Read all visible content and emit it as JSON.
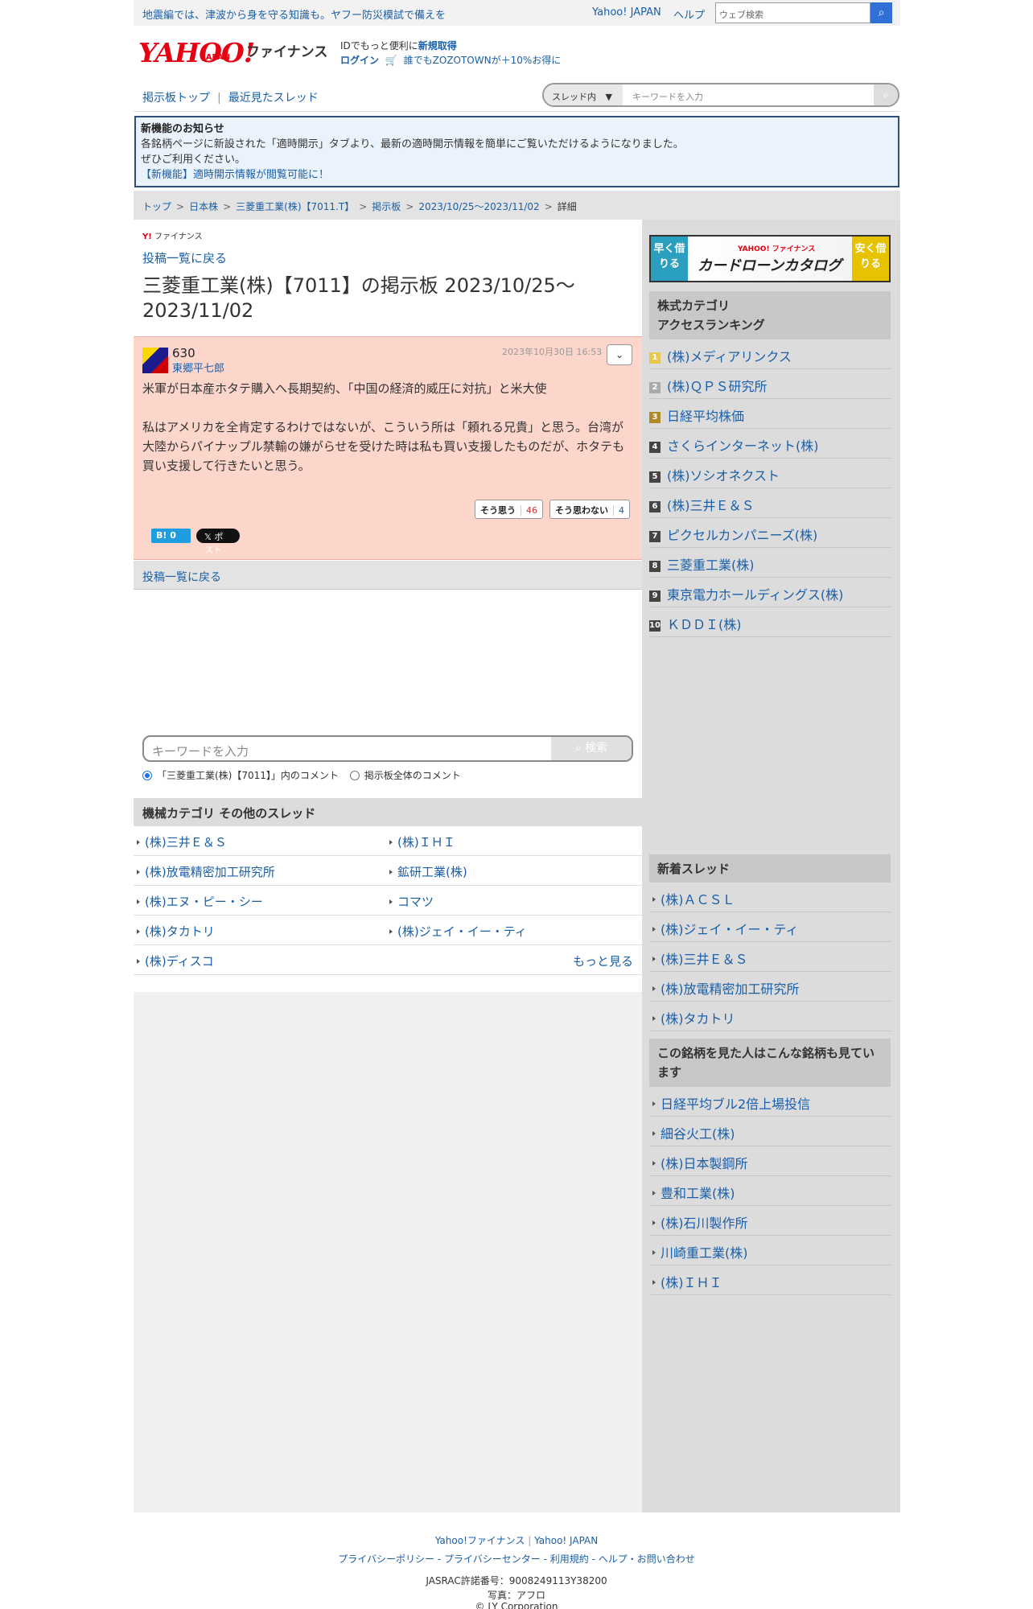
{
  "topbar": {
    "notice": "地震編では、津波から身を守る知識も。ヤフー防災模試で備えを",
    "yahoo_japan": "Yahoo! JAPAN",
    "help": "ヘルプ",
    "web_search_placeholder": "ウェブ検索"
  },
  "header": {
    "logo_text": "YAHOO!",
    "logo_sub": "JAPAN",
    "finance_label": "ファイナンス",
    "id_prefix": "IDでもっと便利に",
    "id_signup": "新規取得",
    "login": "ログイン",
    "zozo_promo": "誰でもZOZOTOWNが＋10%お得に"
  },
  "nav": {
    "board_top": "掲示板トップ",
    "recent_threads": "最近見たスレッド",
    "scope_select": "スレッド内",
    "keyword_placeholder": "キーワードを入力"
  },
  "news": {
    "title": "新機能のお知らせ",
    "line1": "各銘柄ページに新設された「適時開示」タブより、最新の適時開示情報を簡単にご覧いただけるようになりました。",
    "line2": "ぜひご利用ください。",
    "link": "【新機能】適時開示情報が閲覧可能に！"
  },
  "breadcrumb": [
    "トップ",
    "日本株",
    "三菱重工業(株)【7011.T】",
    "掲示板",
    "2023/10/25〜2023/11/02",
    "詳細"
  ],
  "main": {
    "small_brand": "ファイナンス",
    "back_to_list": "投稿一覧に戻る",
    "title": "三菱重工業(株)【7011】の掲示板 2023/10/25〜2023/11/02"
  },
  "post": {
    "number": "630",
    "author": "東郷平七郎",
    "date": "2023年10月30日 16:53",
    "body_line1": "米軍が日本産ホタテ購入へ長期契約、「中国の経済的威圧に対抗」と米大使",
    "body_line2": "私はアメリカを全肯定するわけではないが、こういう所は「頼れる兄貴」と思う。台湾が大陸からパイナップル禁輸の嫌がらせを受けた時は私も買い支援したものだが、ホタテも買い支援して行きたいと思う。",
    "agree_label": "そう思う",
    "agree_count": "46",
    "disagree_label": "そう思わない",
    "disagree_count": "4",
    "hatena": "B! 0",
    "x_post": "𝕏 ポスト"
  },
  "back_to_list_bottom": "投稿一覧に戻る",
  "search": {
    "placeholder": "キーワードを入力",
    "button": "検索",
    "radio_thread": "「三菱重工業(株)【7011】」内のコメント",
    "radio_all": "掲示板全体のコメント"
  },
  "machine_category": {
    "heading": "機械カテゴリ  その他のスレッド",
    "items": [
      "(株)三井Ｅ＆Ｓ",
      "(株)ＩＨＩ",
      "(株)放電精密加工研究所",
      "鉱研工業(株)",
      "(株)エヌ・ピー・シー",
      "コマツ",
      "(株)タカトリ",
      "(株)ジェイ・イー・ティ",
      "(株)ディスコ"
    ],
    "more": "もっと見る"
  },
  "sidebar": {
    "banner_left": "早く借りる",
    "banner_brand": "YAHOO! ファイナンス",
    "banner_main": "カードローンカタログ",
    "banner_right": "安く借りる",
    "ranking_heading_1": "株式カテゴリ",
    "ranking_heading_2": "アクセスランキング",
    "ranking": [
      "(株)メディアリンクス",
      "(株)ＱＰＳ研究所",
      "日経平均株価",
      "さくらインターネット(株)",
      "(株)ソシオネクスト",
      "(株)三井Ｅ＆Ｓ",
      "ピクセルカンパニーズ(株)",
      "三菱重工業(株)",
      "東京電力ホールディングス(株)",
      "ＫＤＤＩ(株)"
    ],
    "new_threads_heading": "新着スレッド",
    "new_threads": [
      "(株)ＡＣＳＬ",
      "(株)ジェイ・イー・ティ",
      "(株)三井Ｅ＆Ｓ",
      "(株)放電精密加工研究所",
      "(株)タカトリ"
    ],
    "also_viewed_heading": "この銘柄を見た人はこんな銘柄も見ています",
    "also_viewed": [
      "日経平均ブル2倍上場投信",
      "細谷火工(株)",
      "(株)日本製鋼所",
      "豊和工業(株)",
      "(株)石川製作所",
      "川崎重工業(株)",
      "(株)ＩＨＩ"
    ]
  },
  "footer": {
    "yf": "Yahoo!ファイナンス",
    "yj": "Yahoo! JAPAN",
    "privacy_policy": "プライバシーポリシー",
    "privacy_center": "プライバシーセンター",
    "terms": "利用規約",
    "help": "ヘルプ・お問い合わせ",
    "jasrac": "JASRAC許諾番号：9008249113Y38200",
    "photo": "写真：アフロ",
    "copyright": "© LY Corporation"
  }
}
